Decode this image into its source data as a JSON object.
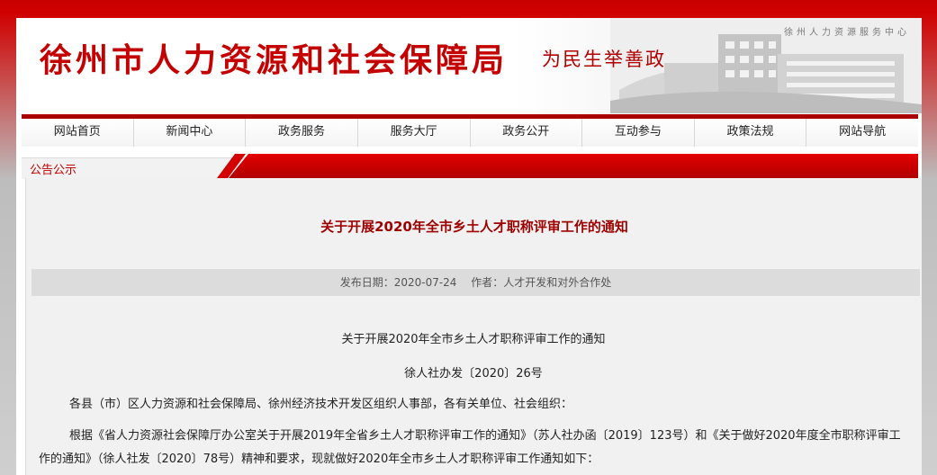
{
  "banner": {
    "title": "徐州市人力资源和社会保障局",
    "slogan": "为民生举善政",
    "center_sign": "徐州人力资源服务中心"
  },
  "nav": {
    "items": [
      "网站首页",
      "新闻中心",
      "政务服务",
      "服务大厅",
      "政务公开",
      "互动参与",
      "政策法规",
      "网站导航"
    ]
  },
  "section": {
    "label": "公告公示"
  },
  "article": {
    "title": "关于开展2020年全市乡土人才职称评审工作的通知",
    "meta": {
      "date": "发布日期：2020-07-24",
      "author": "作者：人才开发和对外合作处"
    },
    "heading": "关于开展2020年全市乡土人才职称评审工作的通知",
    "doc_number": "徐人社办发〔2020〕26号",
    "addressee": "各县（市）区人力资源和社会保障局、徐州经济技术开发区组织人事部，各有关单位、社会组织：",
    "paragraph1": "根据《省人力资源社会保障厅办公室关于开展2019年全省乡土人才职称评审工作的通知》（苏人社办函〔2019〕123号）和《关于做好2020年度全市职称评审工作的通知》（徐人社发〔2020〕78号）精神和要求，现就做好2020年全市乡土人才职称评审工作通知如下："
  },
  "colors": {
    "brand_red": "#c40000",
    "title_red": "#9e0000",
    "nav_border": "#a90000"
  }
}
